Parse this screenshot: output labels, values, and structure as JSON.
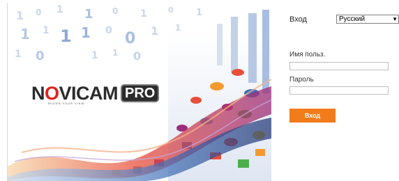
{
  "brand": {
    "logo_main": "N",
    "logo_o": "O",
    "logo_rest": "VICAM",
    "logo_pro": "PRO",
    "tagline": "WIDEN YOUR VIEW",
    "colors": {
      "dark": "#2b2b2b",
      "red": "#e2231a"
    }
  },
  "login": {
    "title": "Вход",
    "language": {
      "selected": "Русский",
      "arrow_icon": "chevron-down-icon"
    },
    "username_label": "Имя польз.",
    "username_value": "",
    "password_label": "Пароль",
    "password_value": "",
    "submit_label": "Вход",
    "accent_color": "#f27c1c"
  }
}
